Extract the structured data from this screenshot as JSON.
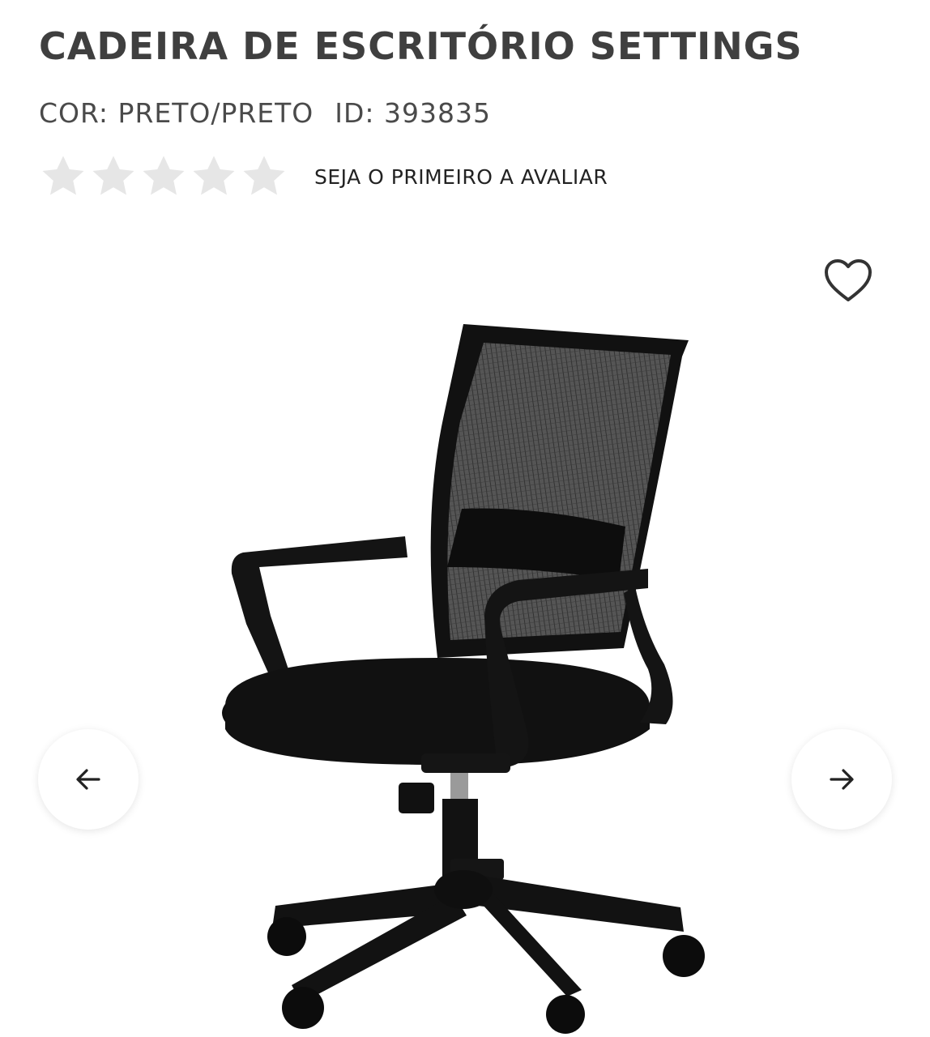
{
  "product": {
    "title": "CADEIRA DE ESCRITÓRIO SETTINGS",
    "color_text": "COR: PRETO/PRETO",
    "id_text": "ID: 393835"
  },
  "rating": {
    "stars_filled": 0,
    "stars_total": 5,
    "cta_label": "SEJA O PRIMEIRO A AVALIAR",
    "star_color_empty": "#e6e6e6"
  },
  "gallery": {
    "image_alt": "office-chair-photo",
    "favorite_icon": "heart-outline-icon",
    "prev_icon": "arrow-left-icon",
    "next_icon": "arrow-right-icon"
  },
  "colors": {
    "text": "#3f3f3f",
    "chair": "#111111",
    "mesh": "#3a3a3a"
  }
}
